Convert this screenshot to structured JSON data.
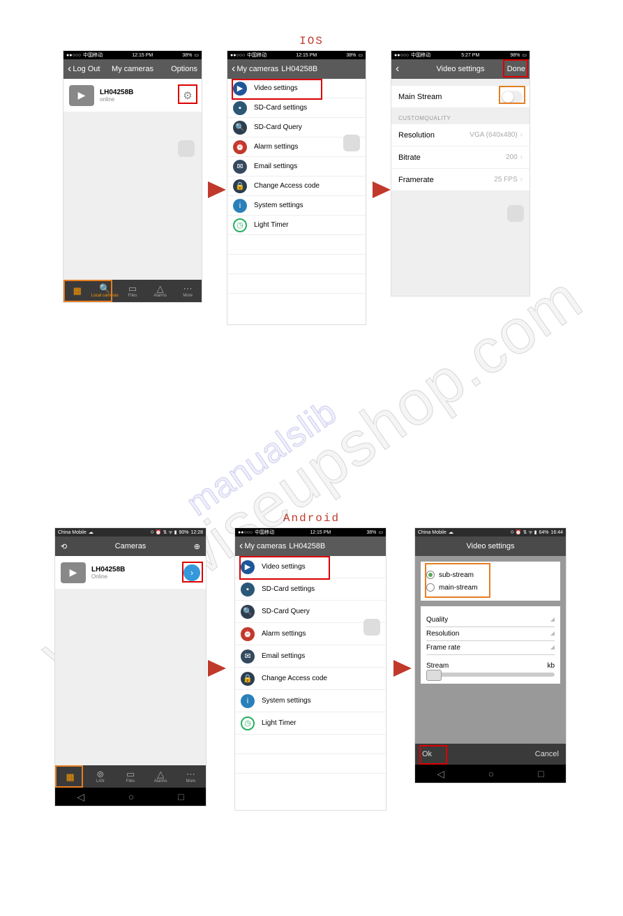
{
  "section_ios": "IOS",
  "section_android": "Android",
  "watermark_main": "www.wiseupshop.com",
  "watermark_sub": "manualslib",
  "ios": {
    "screen1": {
      "status": {
        "carrier": "中国移动",
        "time": "12:15 PM",
        "battery": "38%"
      },
      "nav": {
        "back": "Log Out",
        "title": "My cameras",
        "right": "Options"
      },
      "camera": {
        "name": "LH04258B",
        "status": "online"
      },
      "tabs": [
        "",
        "Local cameras",
        "Files",
        "Alarms",
        "More"
      ]
    },
    "screen2": {
      "status": {
        "carrier": "中国移动",
        "time": "12:15 PM",
        "battery": "38%"
      },
      "nav": {
        "back": "My cameras",
        "title": "LH04258B"
      },
      "items": [
        "Video settings",
        "SD-Card settings",
        "SD-Card Query",
        "Alarm settings",
        "Email settings",
        "Change Access code",
        "System settings",
        "Light Timer"
      ]
    },
    "screen3": {
      "status": {
        "carrier": "中国移动",
        "time": "5:27 PM",
        "battery": "98%"
      },
      "nav": {
        "title": "Video settings",
        "right": "Done"
      },
      "mainstream": "Main Stream",
      "section": "CUSTOMQUALITY",
      "rows": [
        {
          "label": "Resolution",
          "value": "VGA (640x480)"
        },
        {
          "label": "Bitrate",
          "value": "200"
        },
        {
          "label": "Framerate",
          "value": "25 FPS"
        }
      ]
    }
  },
  "android": {
    "screen1": {
      "status": {
        "carrier": "China Mobile",
        "time": "12:28",
        "battery": "90%"
      },
      "nav": {
        "title": "Cameras"
      },
      "camera": {
        "name": "LH04258B",
        "status": "Online"
      },
      "tabs": [
        "",
        "LAN",
        "Files",
        "Alarms",
        "More"
      ]
    },
    "screen2": {
      "status": {
        "carrier": "中国移动",
        "time": "12:15 PM",
        "battery": "38%"
      },
      "nav": {
        "back": "My cameras",
        "title": "LH04258B"
      },
      "items": [
        "Video settings",
        "SD-Card settings",
        "SD-Card Query",
        "Alarm settings",
        "Email settings",
        "Change Access code",
        "System settings",
        "Light Timer"
      ]
    },
    "screen3": {
      "status": {
        "carrier": "China Mobile",
        "time": "16:44",
        "battery": "64%"
      },
      "nav": {
        "title": "Video settings"
      },
      "radio": {
        "sub": "sub-stream",
        "main": "main-stream"
      },
      "fields": [
        "Quality",
        "Resolution",
        "Frame rate"
      ],
      "stream_label": "Stream",
      "stream_unit": "kb",
      "ok": "Ok",
      "cancel": "Cancel"
    }
  }
}
